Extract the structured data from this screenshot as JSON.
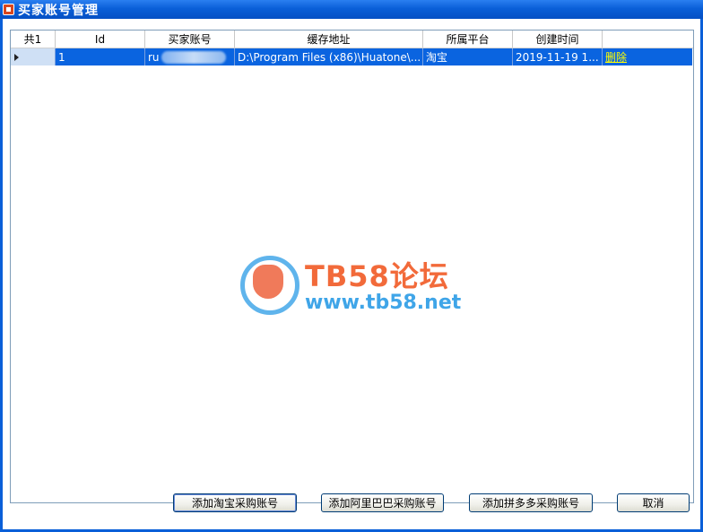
{
  "window": {
    "title": "买家账号管理"
  },
  "grid": {
    "headers": [
      "共1",
      "Id",
      "买家账号",
      "缓存地址",
      "所属平台",
      "创建时间",
      ""
    ],
    "rows": [
      {
        "id": "1",
        "account": "ru",
        "path": "D:\\Program Files (x86)\\Huatone\\...",
        "platform": "淘宝",
        "created": "2019-11-19 1...",
        "action": "删除"
      }
    ]
  },
  "watermark": {
    "title": "TB58论坛",
    "url": "www.tb58.net"
  },
  "buttons": {
    "add_taobao": "添加淘宝采购账号",
    "add_alibaba": "添加阿里巴巴采购账号",
    "add_pdd": "添加拼多多采购账号",
    "cancel": "取消"
  },
  "colors": {
    "selection": "#0a64e0",
    "title_bar": "#0a5fd8",
    "link": "#ffff00"
  }
}
